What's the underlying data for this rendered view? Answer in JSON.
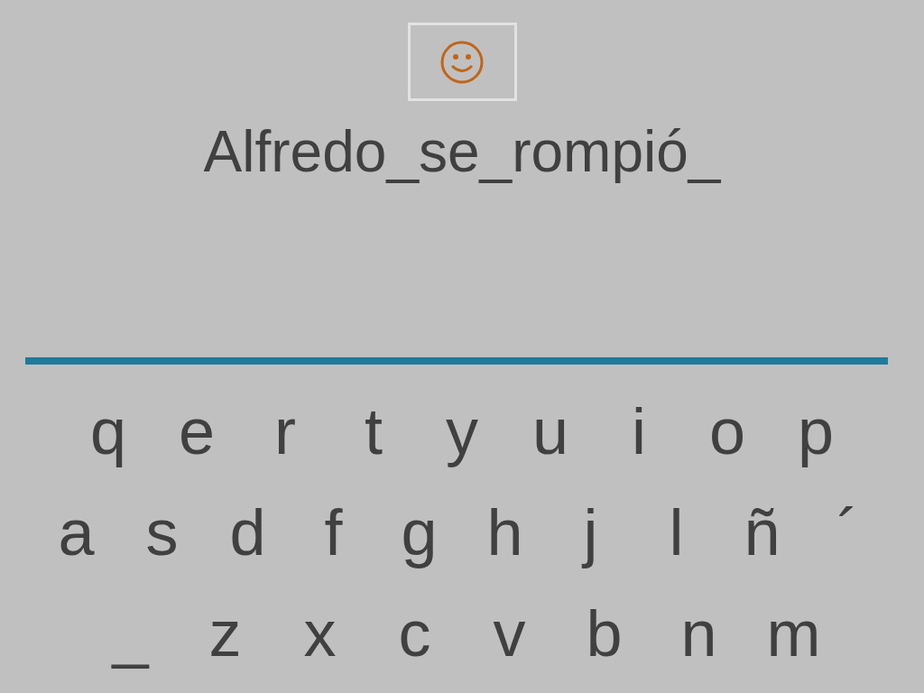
{
  "answer": "Alfredo_se_rompió_",
  "keyboard": [
    [
      "q",
      "e",
      "r",
      "t",
      "y",
      "u",
      "i",
      "o",
      "p"
    ],
    [
      "a",
      "s",
      "d",
      "f",
      "g",
      "h",
      "j",
      "l",
      "ñ",
      "´"
    ],
    [
      "_",
      "z",
      "x",
      "c",
      "v",
      "b",
      "n",
      "m"
    ]
  ]
}
